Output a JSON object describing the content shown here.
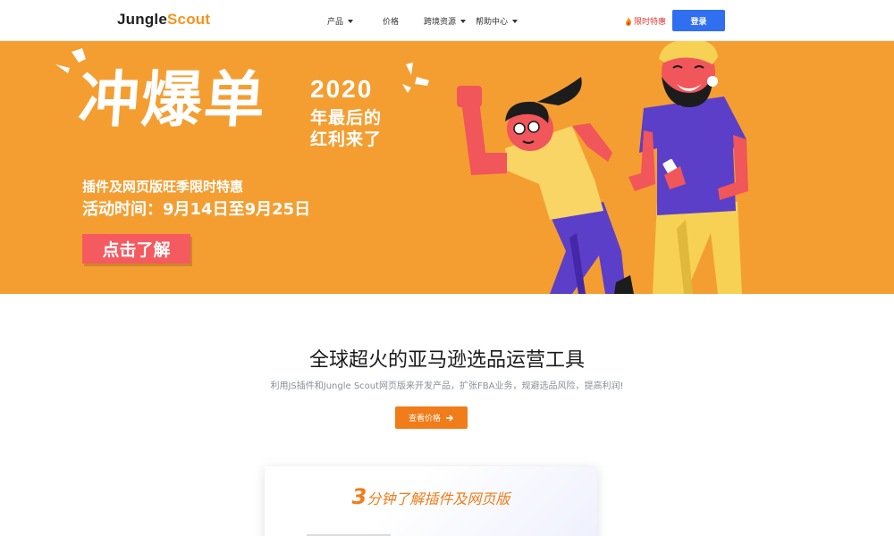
{
  "header": {
    "logo_main": "Jungle",
    "logo_accent": "Scout",
    "nav": [
      {
        "label": "产品",
        "dropdown": true
      },
      {
        "label": "价格",
        "dropdown": false
      },
      {
        "label": "跨境资源",
        "dropdown": true
      },
      {
        "label": "帮助中心",
        "dropdown": true
      }
    ],
    "promo_label": "限时特惠",
    "login_label": "登录"
  },
  "banner": {
    "headline": "冲爆单",
    "year": "2020",
    "year_line1": "年最后的",
    "year_line2": "红利来了",
    "subline1": "插件及网页版旺季限时特惠",
    "subline2": "活动时间：9月14日至9月25日",
    "cta_label": "点击了解"
  },
  "main": {
    "title": "全球超火的亚马逊选品运营工具",
    "subtitle": "利用JS插件和Jungle Scout网页版来开发产品，扩张FBA业务，规避选品风险，提高利润!",
    "price_button": "查看价格",
    "card_title_num": "3",
    "card_title_text": "分钟了解插件及网页版"
  },
  "colors": {
    "banner_bg": "#f49e32",
    "brand_orange": "#f07c1a",
    "login_blue": "#2f6ff0",
    "cta_red": "#f45a5f",
    "promo_red": "#e53935"
  }
}
